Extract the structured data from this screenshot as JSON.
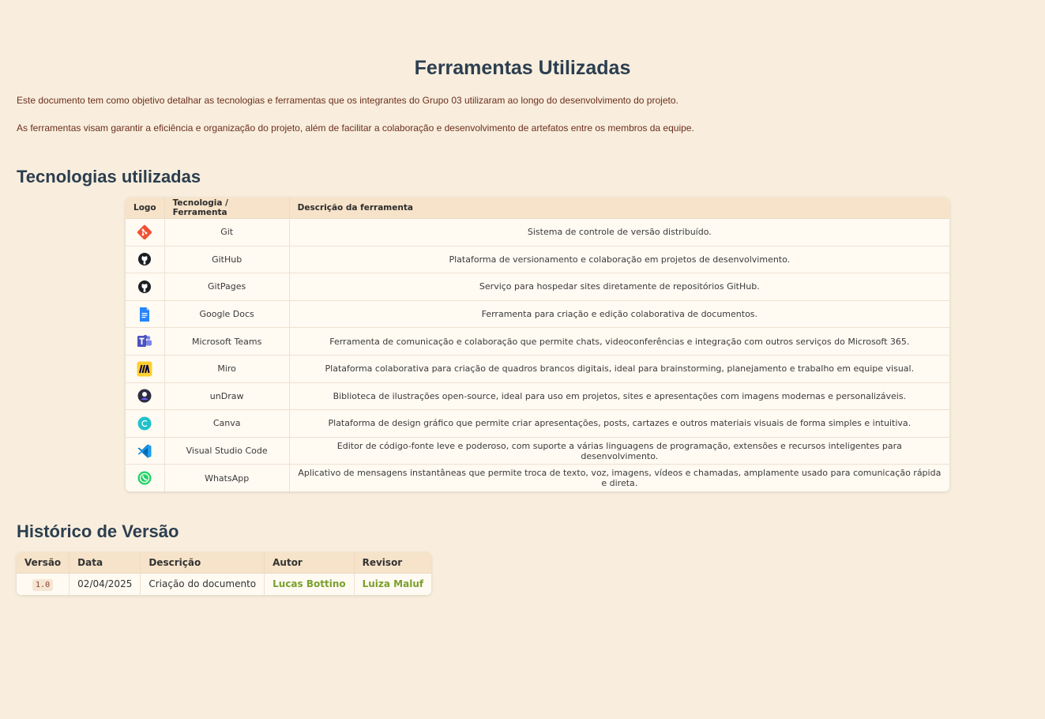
{
  "page": {
    "title": "Ferramentas Utilizadas",
    "intro_1": "Este documento tem como objetivo detalhar as tecnologias e ferramentas que os integrantes do Grupo 03 utilizaram ao longo do desenvolvimento do projeto.",
    "intro_2": "As ferramentas visam garantir a eficiência e organização do projeto, além de facilitar a colaboração e desenvolvimento de artefatos entre os membros da equipe."
  },
  "tools_section": {
    "title": "Tecnologias utilizadas",
    "headers": [
      "Logo",
      "Tecnologia / Ferramenta",
      "Descrição da ferramenta"
    ],
    "rows": [
      {
        "icon": "git-logo-icon",
        "name": "Git",
        "desc": "Sistema de controle de versão distribuído."
      },
      {
        "icon": "github-logo-icon",
        "name": "GitHub",
        "desc": "Plataforma de versionamento e colaboração em projetos de desenvolvimento."
      },
      {
        "icon": "github-logo-icon",
        "name": "GitPages",
        "desc": "Serviço para hospedar sites diretamente de repositórios GitHub."
      },
      {
        "icon": "google-docs-logo-icon",
        "name": "Google Docs",
        "desc": "Ferramenta para criação e edição colaborativa de documentos."
      },
      {
        "icon": "microsoft-teams-logo-icon",
        "name": "Microsoft Teams",
        "desc": "Ferramenta de comunicação e colaboração que permite chats, videoconferências e integração com outros serviços do Microsoft 365."
      },
      {
        "icon": "miro-logo-icon",
        "name": "Miro",
        "desc": "Plataforma colaborativa para criação de quadros brancos digitais, ideal para brainstorming, planejamento e trabalho em equipe visual."
      },
      {
        "icon": "undraw-logo-icon",
        "name": "unDraw",
        "desc": "Biblioteca de ilustrações open-source, ideal para uso em projetos, sites e apresentações com imagens modernas e personalizáveis."
      },
      {
        "icon": "canva-logo-icon",
        "name": "Canva",
        "desc": "Plataforma de design gráfico que permite criar apresentações, posts, cartazes e outros materiais visuais de forma simples e intuitiva."
      },
      {
        "icon": "vscode-logo-icon",
        "name": "Visual Studio Code",
        "desc": "Editor de código-fonte leve e poderoso, com suporte a várias linguagens de programação, extensões e recursos inteligentes para desenvolvimento."
      },
      {
        "icon": "whatsapp-logo-icon",
        "name": "WhatsApp",
        "desc": "Aplicativo de mensagens instantâneas que permite troca de texto, voz, imagens, vídeos e chamadas, amplamente usado para comunicação rápida e direta."
      }
    ]
  },
  "history_section": {
    "title": "Histórico de Versão",
    "headers": [
      "Versão",
      "Data",
      "Descrição",
      "Autor",
      "Revisor"
    ],
    "rows": [
      {
        "version": "1.0",
        "date": "02/04/2025",
        "desc": "Criação do documento",
        "author": "Lucas Bottino",
        "reviewer": "Luiza Maluf"
      }
    ]
  },
  "colors": {
    "background": "#f9eedd",
    "heading": "#2c3e50",
    "intro_text": "#6b2e1f",
    "link": "#7aa02c",
    "table_header": "#f6e3c9"
  }
}
